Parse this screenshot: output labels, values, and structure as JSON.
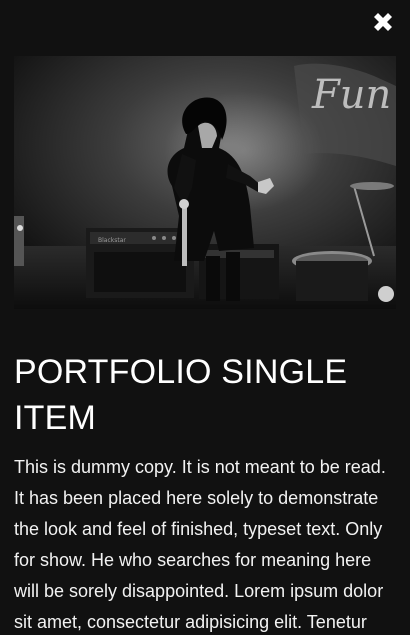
{
  "modal": {
    "close_icon": "close-x-icon",
    "image_alt_icon": "concert-photo",
    "photo_sign_text": "Fun Fr",
    "amp_label": "Blackstar",
    "title": "PORTFOLIO SINGLE ITEM",
    "body": "This is dummy copy. It is not meant to be read. It has been placed here solely to demonstrate the look and feel of finished, typeset text. Only for show. He who searches for meaning here will be sorely disappointed. Lorem ipsum dolor sit amet, consectetur adipisicing elit. Tenetur"
  },
  "colors": {
    "background": "#111111",
    "text": "#ffffff"
  }
}
